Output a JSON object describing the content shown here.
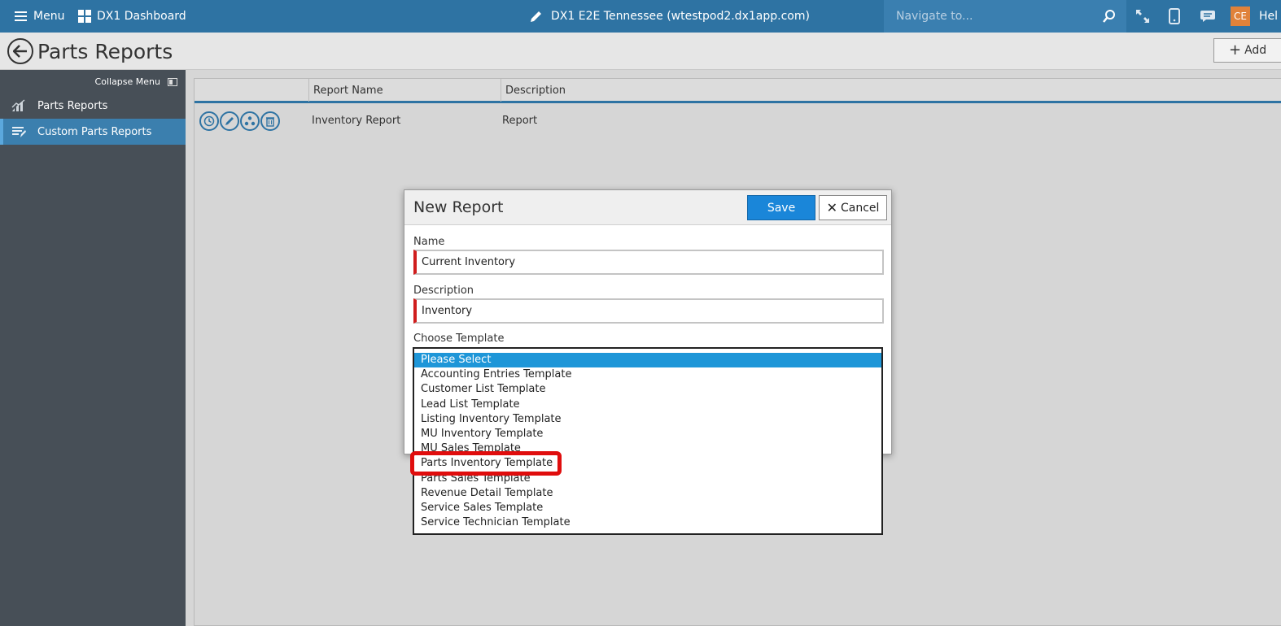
{
  "topbar": {
    "menu_label": "Menu",
    "dashboard_label": "DX1 Dashboard",
    "site_title": "DX1 E2E Tennessee (wtestpod2.dx1app.com)",
    "nav_placeholder": "Navigate to...",
    "avatar_initials": "CE",
    "help_label": "Hel"
  },
  "header": {
    "page_title": "Parts Reports",
    "add_label": "Add"
  },
  "sidebar": {
    "collapse_label": "Collapse Menu",
    "items": [
      {
        "label": "Parts Reports",
        "icon": "chart-icon"
      },
      {
        "label": "Custom Parts Reports",
        "icon": "report-lines-icon"
      }
    ]
  },
  "table": {
    "columns": [
      "",
      "Report Name",
      "Description"
    ],
    "rows": [
      {
        "name": "Inventory Report",
        "description": "Report"
      }
    ]
  },
  "modal": {
    "title": "New Report",
    "save_label": "Save",
    "cancel_label": "Cancel",
    "name_label": "Name",
    "name_value": "Current Inventory",
    "description_label": "Description",
    "description_value": "Inventory",
    "template_label": "Choose Template"
  },
  "template_options": [
    "Please Select",
    "Accounting Entries Template",
    "Customer List Template",
    "Lead List Template",
    "Listing Inventory Template",
    "MU Inventory Template",
    "MU Sales Template",
    "Parts Inventory Template",
    "Parts Sales Template",
    "Revenue Detail Template",
    "Service Sales Template",
    "Service Technician Template"
  ],
  "colors": {
    "topbar": "#2e73a3",
    "sidebar": "#474f57",
    "accent": "#1a86d9",
    "required": "#d01d1d",
    "highlight": "#e00d0d"
  }
}
